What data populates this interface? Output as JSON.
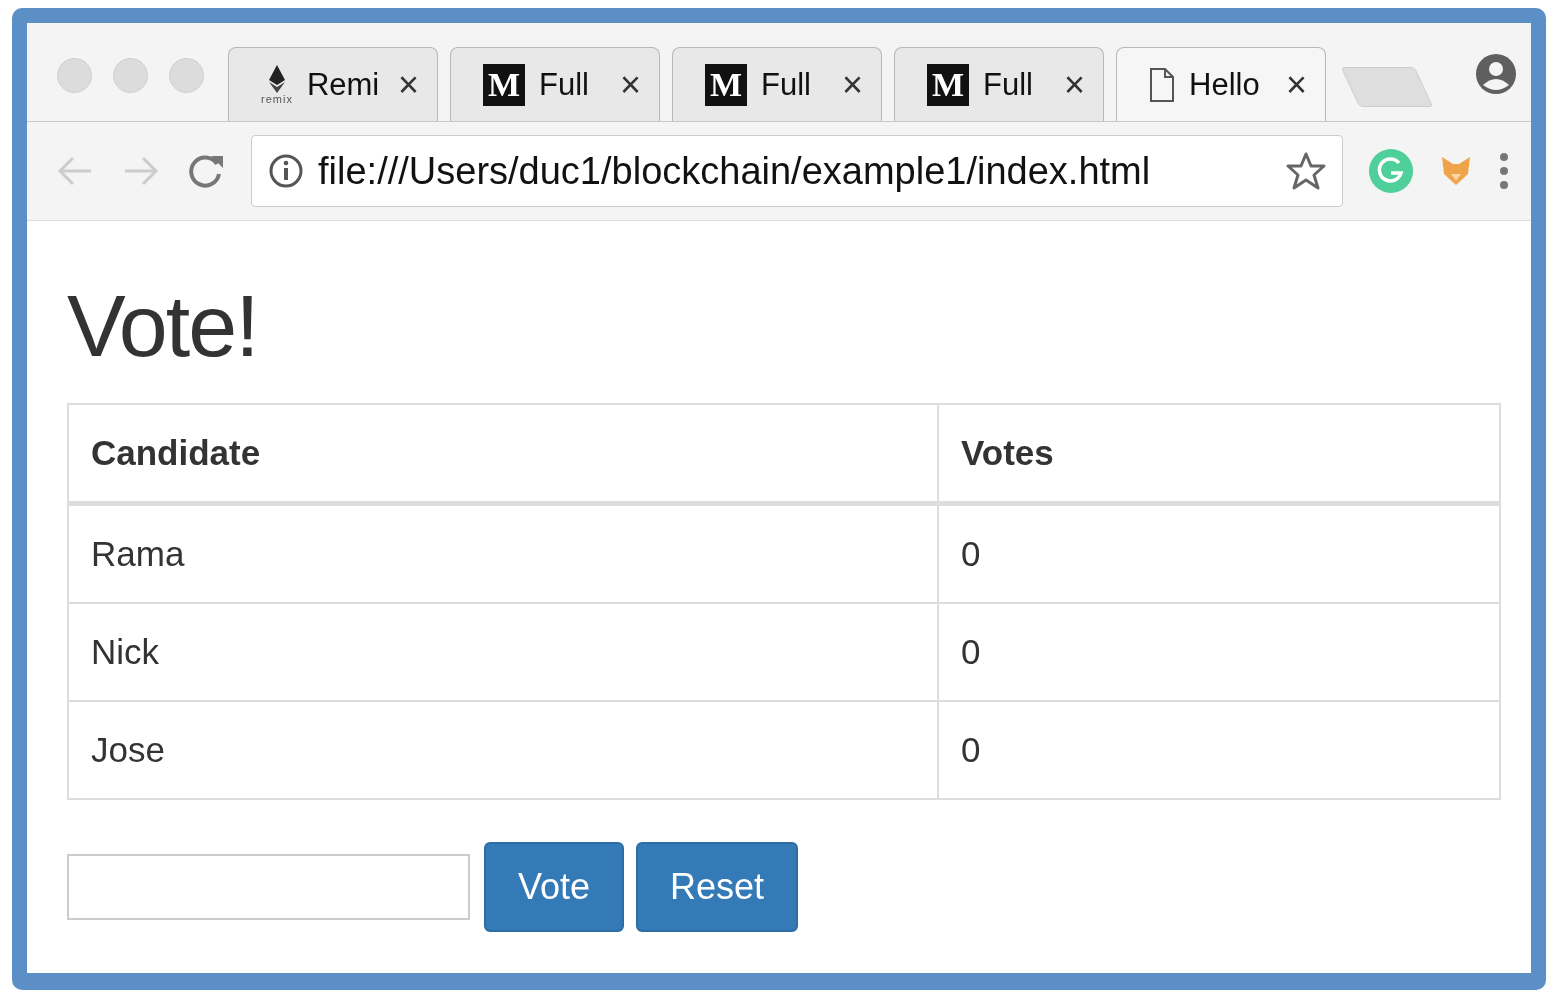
{
  "tabs": [
    {
      "kind": "remix",
      "icon_text": "remix",
      "title": "Remi",
      "selected": false
    },
    {
      "kind": "medium",
      "icon_text": "M",
      "title": "Full",
      "selected": false
    },
    {
      "kind": "medium",
      "icon_text": "M",
      "title": "Full",
      "selected": false
    },
    {
      "kind": "medium",
      "icon_text": "M",
      "title": "Full",
      "selected": false
    },
    {
      "kind": "page",
      "title": "Hello",
      "selected": true
    }
  ],
  "close_glyph": "×",
  "address_bar": {
    "url": "file:///Users/duc1/blockchain/example1/index.html"
  },
  "page": {
    "heading": "Vote!",
    "table": {
      "columns": [
        "Candidate",
        "Votes"
      ],
      "rows": [
        [
          "Rama",
          "0"
        ],
        [
          "Nick",
          "0"
        ],
        [
          "Jose",
          "0"
        ]
      ]
    },
    "buttons": [
      "Vote",
      "Reset"
    ]
  }
}
